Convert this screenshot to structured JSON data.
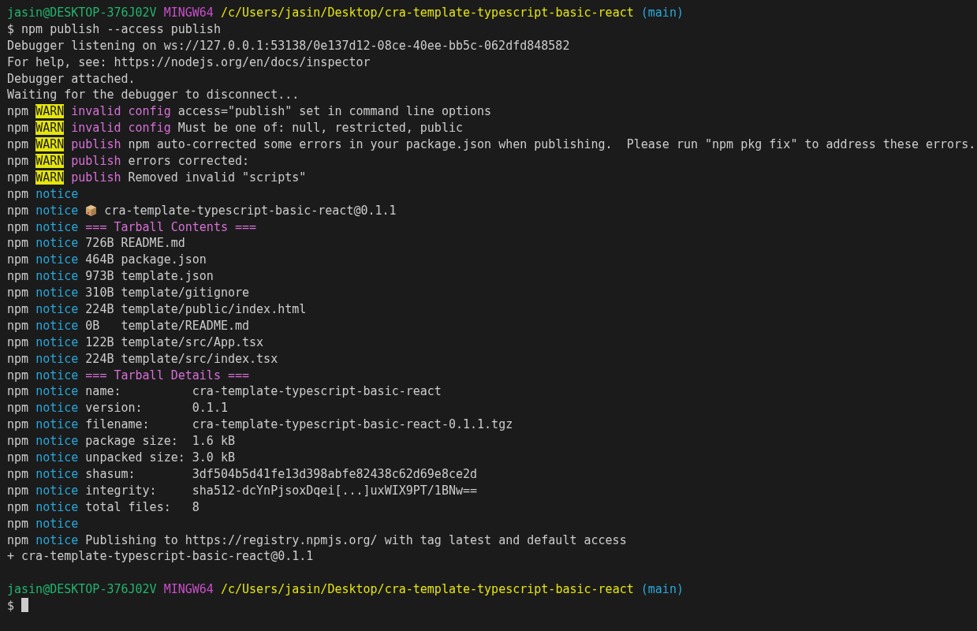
{
  "terminal": {
    "lines": [
      {
        "segments": [
          {
            "kind": "user",
            "text": "jasin@DESKTOP-376J02V"
          },
          {
            "kind": "shell",
            "text": "MINGW64"
          },
          {
            "kind": "path",
            "text": "/c/Users/jasin/Desktop/cra-template-typescript-basic-react"
          },
          {
            "kind": "branch",
            "text": "(main)"
          }
        ]
      },
      {
        "segments": [
          {
            "kind": "dollar",
            "text": "$"
          },
          {
            "kind": "command",
            "text": "npm publish --access publish"
          }
        ]
      },
      {
        "segments": [
          {
            "kind": "text",
            "text": "Debugger listening on ws://127.0.0.1:53138/0e137d12-08ce-40ee-bb5c-062dfd848582"
          }
        ]
      },
      {
        "segments": [
          {
            "kind": "text",
            "text": "For help, see: https://nodejs.org/en/docs/inspector"
          }
        ]
      },
      {
        "segments": [
          {
            "kind": "text",
            "text": "Debugger attached."
          }
        ]
      },
      {
        "segments": [
          {
            "kind": "text",
            "text": "Waiting for the debugger to disconnect..."
          }
        ]
      },
      {
        "segments": [
          {
            "kind": "text",
            "text": "npm"
          },
          {
            "kind": "warn",
            "text": "WARN"
          },
          {
            "kind": "category",
            "text": "invalid config"
          },
          {
            "kind": "text",
            "text": "access=\"publish\" set in command line options"
          }
        ]
      },
      {
        "segments": [
          {
            "kind": "text",
            "text": "npm"
          },
          {
            "kind": "warn",
            "text": "WARN"
          },
          {
            "kind": "category",
            "text": "invalid config"
          },
          {
            "kind": "text",
            "text": "Must be one of: null, restricted, public"
          }
        ]
      },
      {
        "segments": [
          {
            "kind": "text",
            "text": "npm"
          },
          {
            "kind": "warn",
            "text": "WARN"
          },
          {
            "kind": "category",
            "text": "publish"
          },
          {
            "kind": "text",
            "text": "npm auto-corrected some errors in your package.json when publishing.  Please run \"npm pkg fix\" to address these errors."
          }
        ]
      },
      {
        "segments": [
          {
            "kind": "text",
            "text": "npm"
          },
          {
            "kind": "warn",
            "text": "WARN"
          },
          {
            "kind": "category",
            "text": "publish"
          },
          {
            "kind": "text",
            "text": "errors corrected:"
          }
        ]
      },
      {
        "segments": [
          {
            "kind": "text",
            "text": "npm"
          },
          {
            "kind": "warn",
            "text": "WARN"
          },
          {
            "kind": "category",
            "text": "publish"
          },
          {
            "kind": "text",
            "text": "Removed invalid \"scripts\""
          }
        ]
      },
      {
        "segments": [
          {
            "kind": "text",
            "text": "npm"
          },
          {
            "kind": "notice",
            "text": "notice"
          }
        ]
      },
      {
        "segments": [
          {
            "kind": "text",
            "text": "npm"
          },
          {
            "kind": "notice",
            "text": "notice"
          },
          {
            "kind": "package"
          },
          {
            "kind": "text",
            "text": "cra-template-typescript-basic-react@0.1.1"
          }
        ]
      },
      {
        "segments": [
          {
            "kind": "text",
            "text": "npm"
          },
          {
            "kind": "notice",
            "text": "notice"
          },
          {
            "kind": "heading",
            "text": "=== Tarball Contents ==="
          }
        ]
      },
      {
        "segments": [
          {
            "kind": "text",
            "text": "npm"
          },
          {
            "kind": "notice",
            "text": "notice"
          },
          {
            "kind": "text",
            "text": "726B README.md"
          }
        ]
      },
      {
        "segments": [
          {
            "kind": "text",
            "text": "npm"
          },
          {
            "kind": "notice",
            "text": "notice"
          },
          {
            "kind": "text",
            "text": "464B package.json"
          }
        ]
      },
      {
        "segments": [
          {
            "kind": "text",
            "text": "npm"
          },
          {
            "kind": "notice",
            "text": "notice"
          },
          {
            "kind": "text",
            "text": "973B template.json"
          }
        ]
      },
      {
        "segments": [
          {
            "kind": "text",
            "text": "npm"
          },
          {
            "kind": "notice",
            "text": "notice"
          },
          {
            "kind": "text",
            "text": "310B template/gitignore"
          }
        ]
      },
      {
        "segments": [
          {
            "kind": "text",
            "text": "npm"
          },
          {
            "kind": "notice",
            "text": "notice"
          },
          {
            "kind": "text",
            "text": "224B template/public/index.html"
          }
        ]
      },
      {
        "segments": [
          {
            "kind": "text",
            "text": "npm"
          },
          {
            "kind": "notice",
            "text": "notice"
          },
          {
            "kind": "text",
            "text": "0B   template/README.md"
          }
        ]
      },
      {
        "segments": [
          {
            "kind": "text",
            "text": "npm"
          },
          {
            "kind": "notice",
            "text": "notice"
          },
          {
            "kind": "text",
            "text": "122B template/src/App.tsx"
          }
        ]
      },
      {
        "segments": [
          {
            "kind": "text",
            "text": "npm"
          },
          {
            "kind": "notice",
            "text": "notice"
          },
          {
            "kind": "text",
            "text": "224B template/src/index.tsx"
          }
        ]
      },
      {
        "segments": [
          {
            "kind": "text",
            "text": "npm"
          },
          {
            "kind": "notice",
            "text": "notice"
          },
          {
            "kind": "heading",
            "text": "=== Tarball Details ==="
          }
        ]
      },
      {
        "segments": [
          {
            "kind": "text",
            "text": "npm"
          },
          {
            "kind": "notice",
            "text": "notice"
          },
          {
            "kind": "text",
            "text": "name:          cra-template-typescript-basic-react"
          }
        ]
      },
      {
        "segments": [
          {
            "kind": "text",
            "text": "npm"
          },
          {
            "kind": "notice",
            "text": "notice"
          },
          {
            "kind": "text",
            "text": "version:       0.1.1"
          }
        ]
      },
      {
        "segments": [
          {
            "kind": "text",
            "text": "npm"
          },
          {
            "kind": "notice",
            "text": "notice"
          },
          {
            "kind": "text",
            "text": "filename:      cra-template-typescript-basic-react-0.1.1.tgz"
          }
        ]
      },
      {
        "segments": [
          {
            "kind": "text",
            "text": "npm"
          },
          {
            "kind": "notice",
            "text": "notice"
          },
          {
            "kind": "text",
            "text": "package size:  1.6 kB"
          }
        ]
      },
      {
        "segments": [
          {
            "kind": "text",
            "text": "npm"
          },
          {
            "kind": "notice",
            "text": "notice"
          },
          {
            "kind": "text",
            "text": "unpacked size: 3.0 kB"
          }
        ]
      },
      {
        "segments": [
          {
            "kind": "text",
            "text": "npm"
          },
          {
            "kind": "notice",
            "text": "notice"
          },
          {
            "kind": "text",
            "text": "shasum:        3df504b5d41fe13d398abfe82438c62d69e8ce2d"
          }
        ]
      },
      {
        "segments": [
          {
            "kind": "text",
            "text": "npm"
          },
          {
            "kind": "notice",
            "text": "notice"
          },
          {
            "kind": "text",
            "text": "integrity:     sha512-dcYnPjsoxDqei[...]uxWIX9PT/1BNw=="
          }
        ]
      },
      {
        "segments": [
          {
            "kind": "text",
            "text": "npm"
          },
          {
            "kind": "notice",
            "text": "notice"
          },
          {
            "kind": "text",
            "text": "total files:   8"
          }
        ]
      },
      {
        "segments": [
          {
            "kind": "text",
            "text": "npm"
          },
          {
            "kind": "notice",
            "text": "notice"
          }
        ]
      },
      {
        "segments": [
          {
            "kind": "text",
            "text": "npm"
          },
          {
            "kind": "notice",
            "text": "notice"
          },
          {
            "kind": "text",
            "text": "Publishing to https://registry.npmjs.org/ with tag latest and default access"
          }
        ]
      },
      {
        "segments": [
          {
            "kind": "text",
            "text": "+ cra-template-typescript-basic-react@0.1.1"
          }
        ]
      },
      {
        "blank": true
      },
      {
        "segments": [
          {
            "kind": "user",
            "text": "jasin@DESKTOP-376J02V"
          },
          {
            "kind": "shell",
            "text": "MINGW64"
          },
          {
            "kind": "path",
            "text": "/c/Users/jasin/Desktop/cra-template-typescript-basic-react"
          },
          {
            "kind": "branch",
            "text": "(main)"
          }
        ]
      },
      {
        "segments": [
          {
            "kind": "dollar",
            "text": "$"
          },
          {
            "kind": "cursor"
          }
        ]
      }
    ]
  }
}
